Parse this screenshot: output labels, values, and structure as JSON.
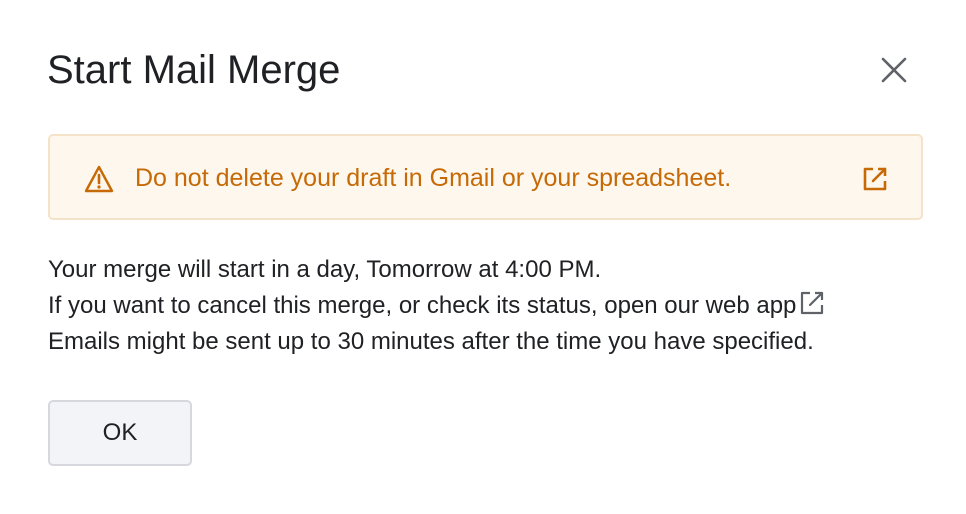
{
  "dialog": {
    "title": "Start Mail Merge",
    "close_icon": "close-icon"
  },
  "warning": {
    "icon": "warning-triangle-icon",
    "text": "Do not delete your draft in Gmail or your spreadsheet.",
    "link_icon": "external-link-icon",
    "color": "#c56a06",
    "background": "#fef7ee"
  },
  "body": {
    "line1": "Your merge will start in a day, Tomorrow at 4:00 PM.",
    "line2": "If you want to cancel this merge, or check its status, open our web app",
    "line2_link_icon": "external-link-icon",
    "line3": "Emails might be sent up to 30 minutes after the time you have specified."
  },
  "buttons": {
    "ok_label": "OK"
  }
}
